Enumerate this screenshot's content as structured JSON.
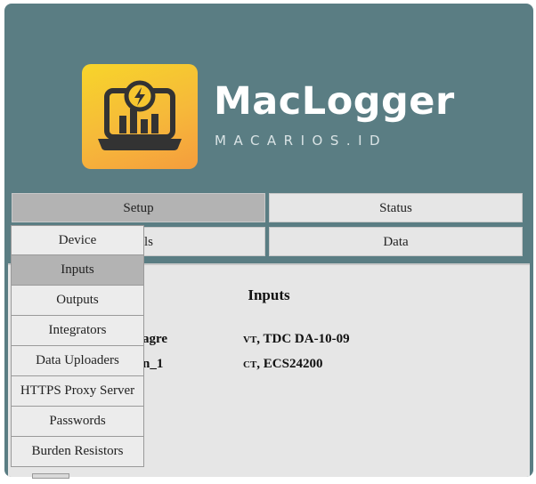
{
  "brand": {
    "title": "MacLogger",
    "subtitle": "MACARIOS.ID",
    "logo_icon": "laptop-bar-chart-lightning-icon",
    "colors": {
      "frame": "#5a7d83",
      "logo_gradient_top": "#f7d52a",
      "logo_gradient_bottom": "#f59d3d"
    }
  },
  "nav": {
    "setup": "Setup",
    "status": "Status",
    "hidden_left_partial": "ls",
    "data": "Data"
  },
  "dropdown": {
    "items": [
      "Device",
      "Inputs",
      "Outputs",
      "Integrators",
      "Data Uploaders",
      "HTTPS Proxy Server",
      "Passwords",
      "Burden Resistors"
    ],
    "active": "Inputs"
  },
  "content": {
    "title": "Inputs",
    "rows": [
      {
        "left_partial": "agre",
        "type_abbr": "VT",
        "sep": ",",
        "value": "TDC DA-10-09"
      },
      {
        "left_partial": "n_1",
        "type_abbr": "CT",
        "sep": ",",
        "value": "ECS24200"
      }
    ]
  }
}
